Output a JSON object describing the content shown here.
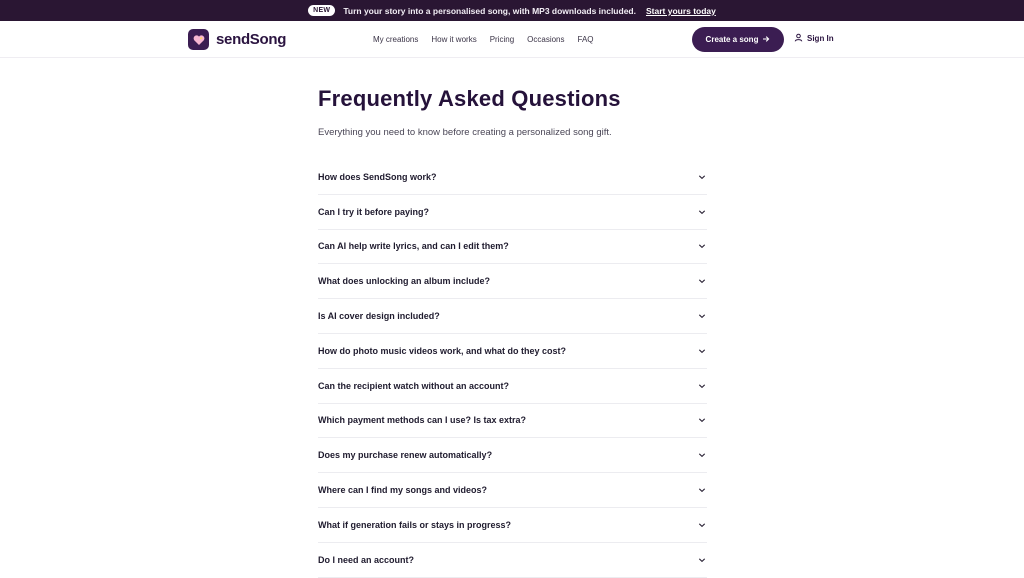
{
  "announcement": {
    "badge": "NEW",
    "text": "Turn your story into a personalised song, with MP3 downloads included.",
    "link": "Start yours today"
  },
  "header": {
    "logo_text": "sendSong",
    "nav": [
      "My creations",
      "How it works",
      "Pricing",
      "Occasions",
      "FAQ"
    ],
    "create_label": "Create a song",
    "signin_label": "Sign In"
  },
  "page": {
    "title": "Frequently Asked Questions",
    "subtitle": "Everything you need to know before creating a personalized song gift."
  },
  "faq": [
    "How does SendSong work?",
    "Can I try it before paying?",
    "Can AI help write lyrics, and can I edit them?",
    "What does unlocking an album include?",
    "Is AI cover design included?",
    "How do photo music videos work, and what do they cost?",
    "Can the recipient watch without an account?",
    "Which payment methods can I use? Is tax extra?",
    "Does my purchase renew automatically?",
    "Where can I find my songs and videos?",
    "What if generation fails or stays in progress?",
    "Do I need an account?"
  ],
  "colors": {
    "brand_dark": "#2a1633",
    "button": "#3b1d52",
    "logo_heart": "#f7b6d2"
  },
  "icons": {
    "logo": "heart-note-icon",
    "create": "arrow-right-icon",
    "signin": "user-icon",
    "faq_toggle": "chevron-down-icon"
  }
}
